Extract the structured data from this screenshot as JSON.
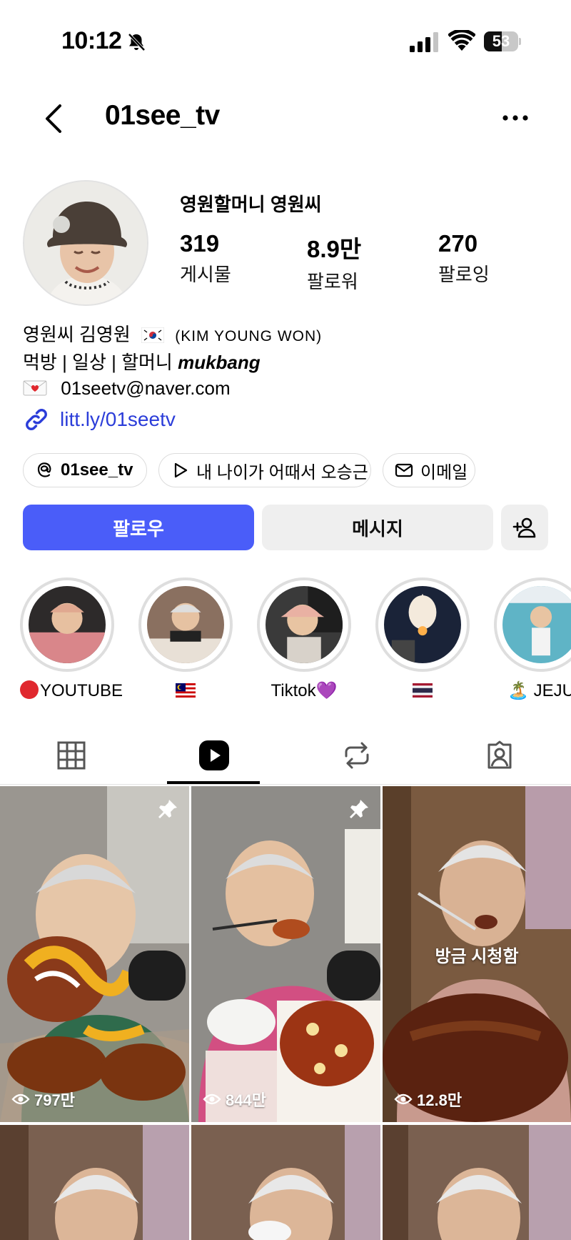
{
  "status_bar": {
    "time": "10:12",
    "battery": "53",
    "battery_level": 0.53
  },
  "header": {
    "username": "01see_tv"
  },
  "profile": {
    "display_name": "영원할머니 영원씨",
    "stats": [
      {
        "value": "319",
        "label": "게시물"
      },
      {
        "value": "8.9만",
        "label": "팔로워"
      },
      {
        "value": "270",
        "label": "팔로잉"
      }
    ]
  },
  "bio": {
    "line1_korean": "영원씨 김영원",
    "line1_latin": "(KIM YOUNG WON)",
    "line2_text": "먹방 | 일상 | 할머니",
    "line2_italic": "mukbang",
    "email": "01seetv@naver.com",
    "link": "litt.ly/01seetv"
  },
  "chips": [
    {
      "label": "01see_tv",
      "icon": "threads-icon"
    },
    {
      "label": "내 나이가 어때서 오승근",
      "icon": "play-icon"
    },
    {
      "label": "이메일",
      "icon": "mail-icon"
    }
  ],
  "actions": {
    "follow": "팔로우",
    "message": "메시지"
  },
  "highlights": [
    {
      "label": "YOUTUBE"
    },
    {
      "label": ""
    },
    {
      "label": "Tiktok💜"
    },
    {
      "label": ""
    },
    {
      "label": "🏝️ JEJU"
    }
  ],
  "tabs": [
    "grid-icon",
    "reels-icon",
    "reposts-icon",
    "tagged-icon"
  ],
  "grid": {
    "tiles": [
      {
        "views": "797만",
        "pinned": true
      },
      {
        "views": "844만",
        "pinned": true
      },
      {
        "views": "12.8만",
        "pinned": false,
        "overlay": "방금 시청함"
      }
    ]
  },
  "colors": {
    "accent": "#4a5df9",
    "link": "#2b3dd9"
  }
}
